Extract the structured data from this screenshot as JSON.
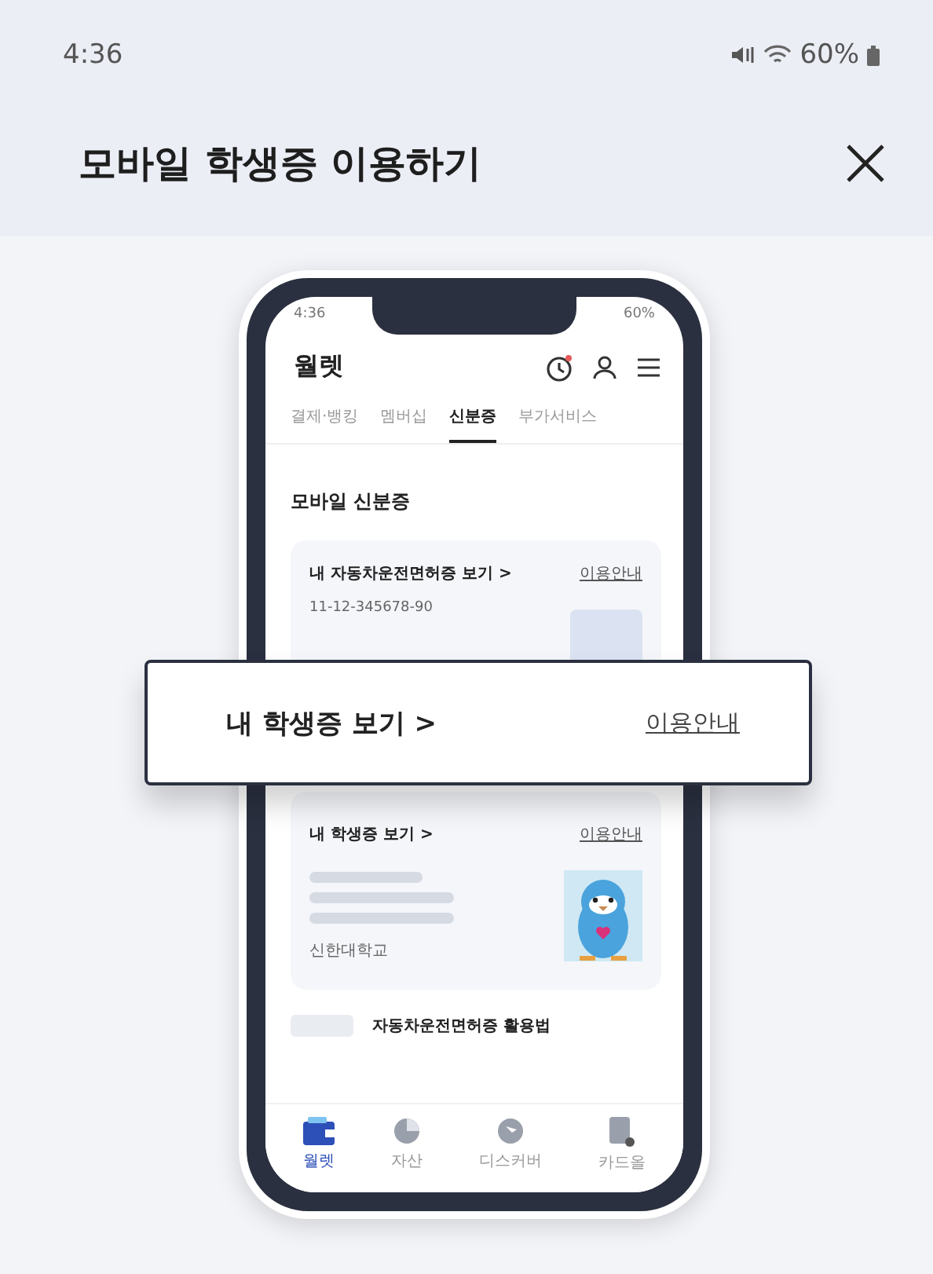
{
  "status_bar": {
    "time": "4:36",
    "battery": "60%"
  },
  "header": {
    "title": "모바일 학생증 이용하기"
  },
  "phone": {
    "status_bar": {
      "time": "4:36",
      "battery": "60%"
    },
    "title": "월렛",
    "tabs": [
      {
        "label": "결제·뱅킹",
        "selected": false
      },
      {
        "label": "멤버십",
        "selected": false
      },
      {
        "label": "신분증",
        "selected": true
      },
      {
        "label": "부가서비스",
        "selected": false
      }
    ],
    "section_title": "모바일 신분증",
    "cards": [
      {
        "kind": "license",
        "title": "내 자동차운전면허증 보기 >",
        "link": "이용안내",
        "number": "11-12-345678-90"
      },
      {
        "kind": "student",
        "title": "내 학생증 보기 >",
        "link": "이용안내",
        "school": "신한대학교"
      }
    ],
    "banner": "자동차운전면허증 활용법",
    "nav": [
      {
        "kind": "wallet",
        "label": "월렛",
        "selected": true
      },
      {
        "kind": "asset",
        "label": "자산",
        "selected": false
      },
      {
        "kind": "discover",
        "label": "디스커버",
        "selected": false
      },
      {
        "kind": "card",
        "label": "카드올",
        "selected": false
      }
    ]
  },
  "callout": {
    "title": "내 학생증 보기 >",
    "link": "이용안내"
  }
}
